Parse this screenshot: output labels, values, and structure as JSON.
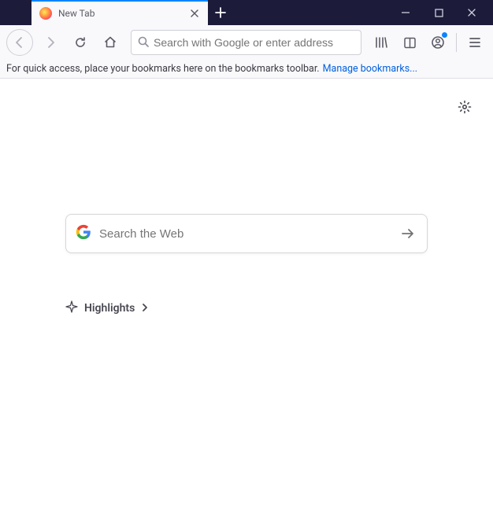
{
  "titlebar": {
    "tab_title": "New Tab"
  },
  "toolbar": {
    "urlbar_placeholder": "Search with Google or enter address"
  },
  "bookmarks": {
    "hint": "For quick access, place your bookmarks here on the bookmarks toolbar.",
    "manage_link": "Manage bookmarks..."
  },
  "content": {
    "search_placeholder": "Search the Web",
    "highlights_label": "Highlights"
  }
}
